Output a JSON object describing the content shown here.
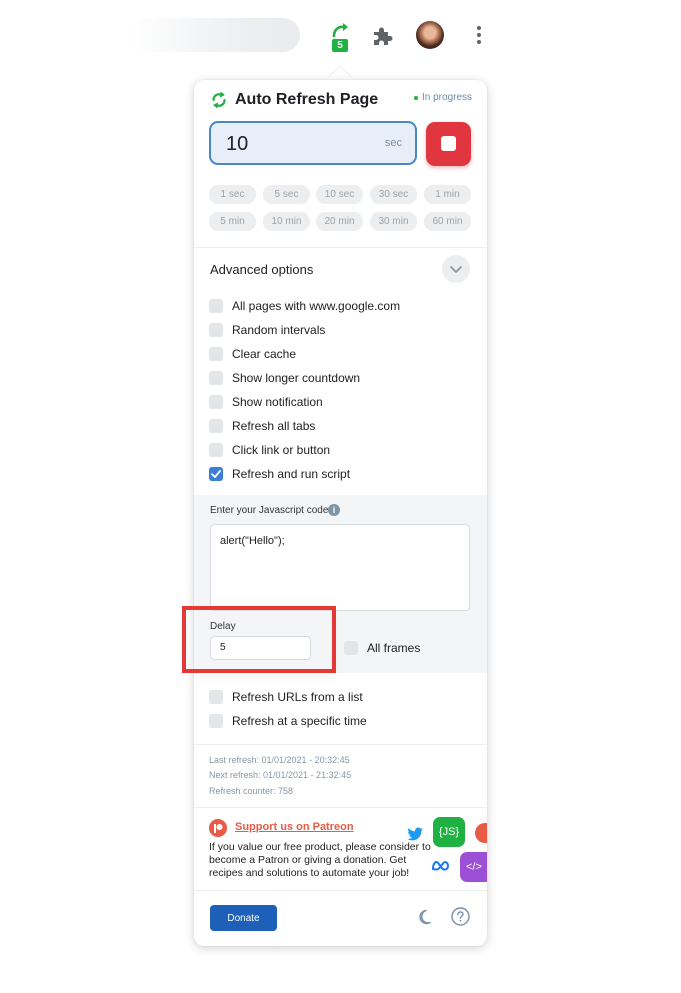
{
  "toolbar": {
    "extension_badge": "5",
    "icons": [
      "auto-refresh-extension-icon",
      "extensions-puzzle-icon",
      "profile-avatar",
      "more-menu-icon"
    ]
  },
  "popup": {
    "title": "Auto Refresh Page",
    "status": "In progress",
    "interval": {
      "value": "10",
      "unit": "sec"
    },
    "presets": [
      "1 sec",
      "5 sec",
      "10 sec",
      "30 sec",
      "1 min",
      "5 min",
      "10 min",
      "20 min",
      "30 min",
      "60 min"
    ],
    "advanced": {
      "title": "Advanced options",
      "options": [
        {
          "label": "All pages with www.google.com",
          "checked": false
        },
        {
          "label": "Random intervals",
          "checked": false
        },
        {
          "label": "Clear cache",
          "checked": false
        },
        {
          "label": "Show longer countdown",
          "checked": false
        },
        {
          "label": "Show notification",
          "checked": false
        },
        {
          "label": "Refresh all tabs",
          "checked": false
        },
        {
          "label": "Click link or button",
          "checked": false
        },
        {
          "label": "Refresh and run script",
          "checked": true
        }
      ],
      "script": {
        "label": "Enter your Javascript code",
        "code": "alert(\"Hello\");",
        "delay_label": "Delay",
        "delay_value": "5",
        "all_frames_label": "All frames",
        "all_frames_checked": false
      },
      "more_options": [
        {
          "label": "Refresh URLs from a list",
          "checked": false
        },
        {
          "label": "Refresh at a specific time",
          "checked": false
        }
      ]
    },
    "info": {
      "last_refresh": "Last refresh: 01/01/2021 - 20:32:45",
      "next_refresh": "Next refresh: 01/01/2021 - 21:32:45",
      "counter": "Refresh counter: 758"
    },
    "support": {
      "link": "Support us on Patreon",
      "text": "If you value our free product, please consider to become a Patron or giving a donation. Get recipes and solutions to automate your job!",
      "js_badge": "{JS}",
      "code_badge": "</>"
    },
    "footer": {
      "donate": "Donate"
    }
  },
  "colors": {
    "accent": "#1fb141",
    "stop": "#e0363f",
    "primary_button": "#1e5fb8",
    "checkbox_checked": "#3a7fd5",
    "patreon": "#e85b46",
    "highlight": "#e53935"
  }
}
